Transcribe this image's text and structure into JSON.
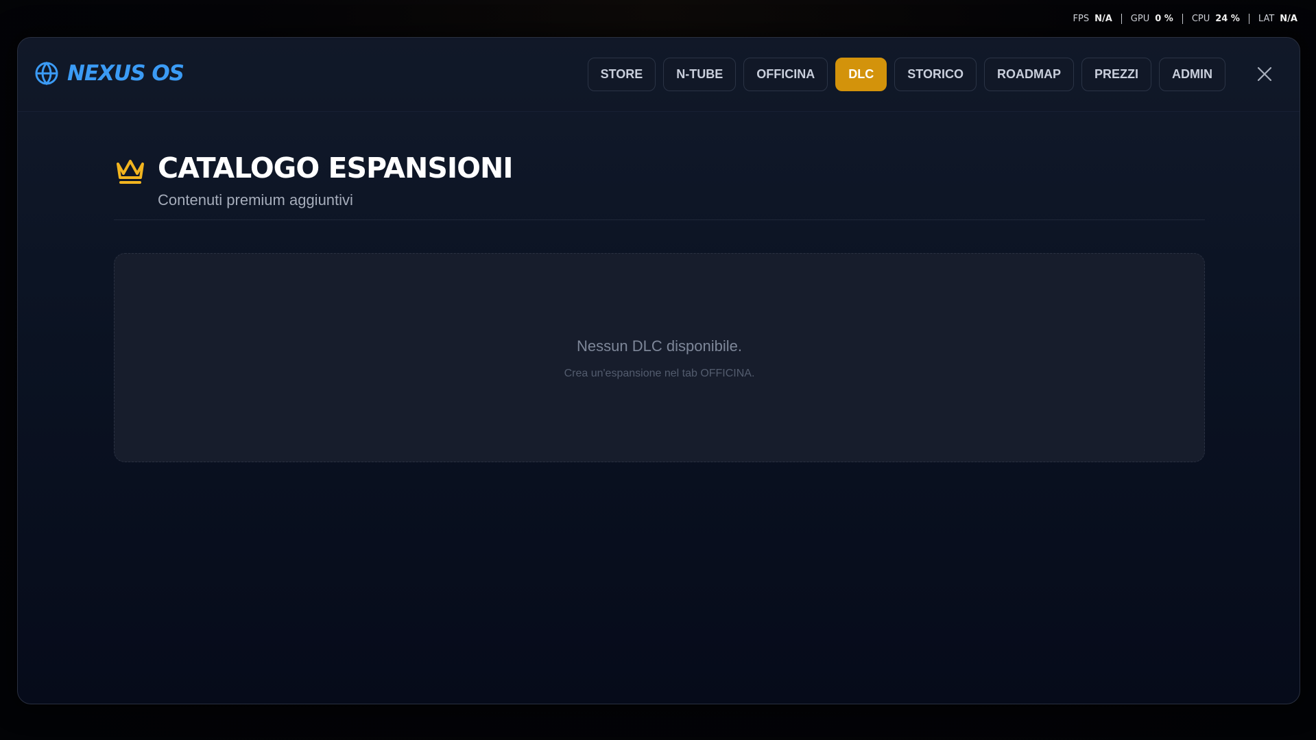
{
  "hud": {
    "fps_label": "FPS",
    "fps_value": "N/A",
    "gpu_label": "GPU",
    "gpu_value": "0 %",
    "cpu_label": "CPU",
    "cpu_value": "24 %",
    "lat_label": "LAT",
    "lat_value": "N/A"
  },
  "app": {
    "brand": "NEXUS OS",
    "brand_icon": "globe-icon",
    "accent_color": "#d3930b",
    "brand_color": "#3b9bf5"
  },
  "nav": {
    "tabs": [
      {
        "label": "STORE"
      },
      {
        "label": "N-TUBE"
      },
      {
        "label": "OFFICINA"
      },
      {
        "label": "DLC",
        "active": true
      },
      {
        "label": "STORICO"
      },
      {
        "label": "ROADMAP"
      },
      {
        "label": "PREZZI"
      },
      {
        "label": "ADMIN"
      }
    ],
    "close_icon": "close-icon"
  },
  "page": {
    "icon": "crown-icon",
    "title": "CATALOGO ESPANSIONI",
    "subtitle": "Contenuti premium aggiuntivi"
  },
  "empty_state": {
    "title": "Nessun DLC disponibile.",
    "hint": "Crea un'espansione nel tab OFFICINA."
  }
}
